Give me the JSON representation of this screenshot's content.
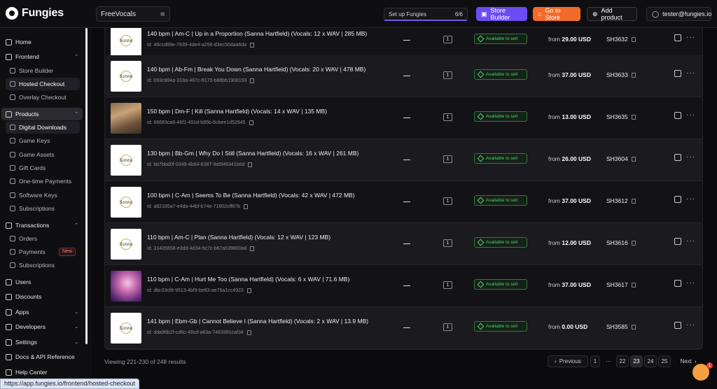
{
  "brand": {
    "name": "Fungies"
  },
  "topbar": {
    "store_name": "FreeVocals",
    "setup_label": "Set up Fungies",
    "setup_progress": "6/6",
    "store_builder": "Store Builder",
    "go_to_store": "Go to Store",
    "add_product": "Add product",
    "user_email": "tester@fungies.io"
  },
  "sidebar": {
    "home": "Home",
    "frontend": "Frontend",
    "store_builder": "Store Builder",
    "hosted_checkout": "Hosted Checkout",
    "overlay_checkout": "Overlay Checkout",
    "products": "Products",
    "digital_downloads": "Digital Downloads",
    "game_keys": "Game Keys",
    "game_assets": "Game Assets",
    "gift_cards": "Gift Cards",
    "one_time_payments": "One-time Payments",
    "software_keys": "Software Keys",
    "subscriptions_products": "Subscriptions",
    "transactions": "Transactions",
    "orders": "Orders",
    "payments": "Payments",
    "payments_badge": "New",
    "subscriptions_tx": "Subscriptions",
    "users": "Users",
    "discounts": "Discounts",
    "apps": "Apps",
    "developers": "Developers",
    "settings": "Settings",
    "docs": "Docs & API Reference",
    "help": "Help Center"
  },
  "products": [
    {
      "title": "140 bpm | Am-C | Up in a Proportion (Sanna Hartfield) (Vocals: 12 x WAV | 285 MB)",
      "id": "id: 46ccd89e-7939-4de4-a256-d3ec50daa6da",
      "dash": "—",
      "qty": "1",
      "status": "Available to sell",
      "price_prefix": "from",
      "price": "29.00 USD",
      "sku": "SH3632",
      "thumb": "logo",
      "thumb_text": "Sanna"
    },
    {
      "title": "140 bpm | Ab-Fm | Break You Down (Sanna Hartfield) (Vocals: 20 x WAV | 478 MB)",
      "id": "id: 093c884a-318a-467c-9170-b88bb1908193",
      "dash": "—",
      "qty": "1",
      "status": "Available to sell",
      "price_prefix": "from",
      "price": "37.00 USD",
      "sku": "SH3633",
      "thumb": "logo",
      "thumb_text": "Sanna"
    },
    {
      "title": "150 bpm | Dm-F | Kill (Sanna Hartfield) (Vocals: 14 x WAV | 135 MB)",
      "id": "id: 66683ca6-46f1-491d-b95b-8cbee1d52945",
      "dash": "—",
      "qty": "1",
      "status": "Available to sell",
      "price_prefix": "from",
      "price": "13.00 USD",
      "sku": "SH3635",
      "thumb": "road",
      "thumb_text": ""
    },
    {
      "title": "130 bpm | Bb-Gm | Why Do I Still (Sanna Hartfield) (Vocals: 16 x WAV | 261 MB)",
      "id": "id: bb7bbd0f-0349-4b64-8387-9a5f46341b6d",
      "dash": "—",
      "qty": "1",
      "status": "Available to sell",
      "price_prefix": "from",
      "price": "26.00 USD",
      "sku": "SH3604",
      "thumb": "logo",
      "thumb_text": "Sanna"
    },
    {
      "title": "100 bpm | C-Am | Seems To Be (Sanna Hartfield) (Vocals: 42 x WAV | 472 MB)",
      "id": "id: a82185a7-e4da-44bf-b74e-71802cff87b",
      "dash": "—",
      "qty": "1",
      "status": "Available to sell",
      "price_prefix": "from",
      "price": "37.00 USD",
      "sku": "SH3612",
      "thumb": "logo",
      "thumb_text": "Sanna"
    },
    {
      "title": "110 bpm | Am-C | Plan (Sanna Hartfield) (Vocals: 12 x WAV | 123 MB)",
      "id": "id: 31405858-e3dd-4d34-9c7c-b67a539800a8",
      "dash": "—",
      "qty": "1",
      "status": "Available to sell",
      "price_prefix": "from",
      "price": "12.00 USD",
      "sku": "SH3616",
      "thumb": "logo",
      "thumb_text": "Sanna"
    },
    {
      "title": "110 bpm | C-Am | Hurt Me Too (Sanna Hartfield) (Vocals: 6 x WAV | 71.6 MB)",
      "id": "id: dbc33cf8-9513-4bf9-be83-ae76a1cc4923",
      "dash": "—",
      "qty": "1",
      "status": "Available to sell",
      "price_prefix": "from",
      "price": "37.00 USD",
      "sku": "SH3617",
      "thumb": "pink",
      "thumb_text": ""
    },
    {
      "title": "141 bpm | Ebm-Gb | Cannot Believe I (Sanna Hartfield) (Vocals: 2 x WAV | 13.9 MB)",
      "id": "id: dda96b2f-cd8c-48cd-a63a-7483391caf34",
      "dash": "—",
      "qty": "1",
      "status": "Available to sell",
      "price_prefix": "from",
      "price": "0.00 USD",
      "sku": "SH3585",
      "thumb": "logo",
      "thumb_text": "Sanna"
    }
  ],
  "footer": {
    "viewing": "Viewing 221-230 of 248 results",
    "previous": "Previous",
    "pages": [
      "1",
      "···",
      "22",
      "23",
      "24",
      "25"
    ],
    "current_page": "23",
    "next": "Next"
  },
  "chat": {
    "badge": "1"
  },
  "status_url": "https://app.fungies.io/frontend/hosted-checkout"
}
